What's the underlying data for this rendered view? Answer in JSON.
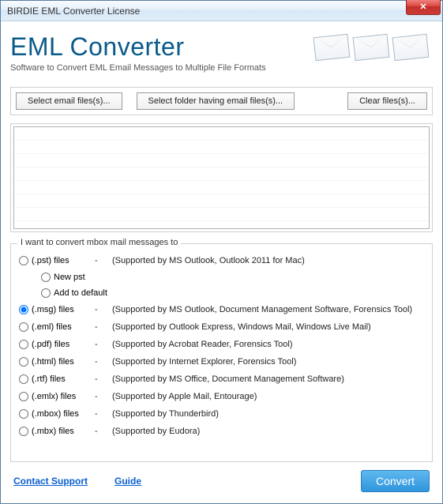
{
  "window": {
    "title": "BIRDIE EML Converter License"
  },
  "header": {
    "title": "EML Converter",
    "subtitle": "Software to Convert EML Email Messages to Multiple File Formats"
  },
  "toolbar": {
    "select_files": "Select email files(s)...",
    "select_folder": "Select folder having email files(s)...",
    "clear_files": "Clear files(s)..."
  },
  "formats": {
    "legend": "I want to convert mbox mail messages to",
    "options": [
      {
        "id": "pst",
        "label": "(.pst) files",
        "desc": "(Supported by MS Outlook, Outlook 2011 for Mac)",
        "selected": false,
        "sub": [
          {
            "id": "newpst",
            "label": "New pst",
            "selected": false
          },
          {
            "id": "adddef",
            "label": "Add to default",
            "selected": false
          }
        ]
      },
      {
        "id": "msg",
        "label": "(.msg) files",
        "desc": "(Supported by MS Outlook, Document Management Software, Forensics Tool)",
        "selected": true
      },
      {
        "id": "eml",
        "label": "(.eml) files",
        "desc": "(Supported by Outlook Express,  Windows Mail, Windows Live Mail)",
        "selected": false
      },
      {
        "id": "pdf",
        "label": "(.pdf) files",
        "desc": "(Supported by Acrobat Reader, Forensics Tool)",
        "selected": false
      },
      {
        "id": "html",
        "label": "(.html) files",
        "desc": "(Supported by Internet Explorer, Forensics Tool)",
        "selected": false
      },
      {
        "id": "rtf",
        "label": "(.rtf) files",
        "desc": "(Supported by MS Office, Document Management Software)",
        "selected": false
      },
      {
        "id": "emlx",
        "label": "(.emlx) files",
        "desc": "(Supported by Apple Mail, Entourage)",
        "selected": false
      },
      {
        "id": "mbox",
        "label": "(.mbox) files",
        "desc": "(Supported by Thunderbird)",
        "selected": false
      },
      {
        "id": "mbx",
        "label": "(.mbx) files",
        "desc": "(Supported by Eudora)",
        "selected": false
      }
    ],
    "dash": "-"
  },
  "footer": {
    "support": "Contact Support",
    "guide": "Guide",
    "convert": "Convert"
  }
}
